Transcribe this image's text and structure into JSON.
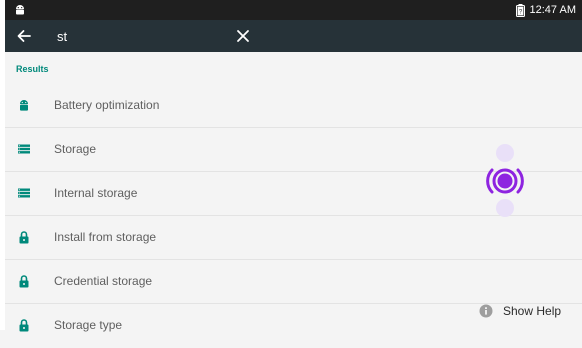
{
  "status_bar": {
    "time": "12:47 AM"
  },
  "search": {
    "value": "st",
    "placeholder": ""
  },
  "results": {
    "header": "Results",
    "items": [
      {
        "label": "Battery optimization",
        "icon": "android-icon"
      },
      {
        "label": "Storage",
        "icon": "storage-icon"
      },
      {
        "label": "Internal storage",
        "icon": "storage-icon"
      },
      {
        "label": "Install from storage",
        "icon": "lock-icon"
      },
      {
        "label": "Credential storage",
        "icon": "lock-icon"
      },
      {
        "label": "Storage type",
        "icon": "lock-icon"
      }
    ]
  },
  "help": {
    "label": "Show Help"
  },
  "colors": {
    "accent": "#00897b",
    "search_bar": "#263238",
    "status_bar": "#1f1f1f",
    "touch_indicator": "#8e24e0"
  }
}
